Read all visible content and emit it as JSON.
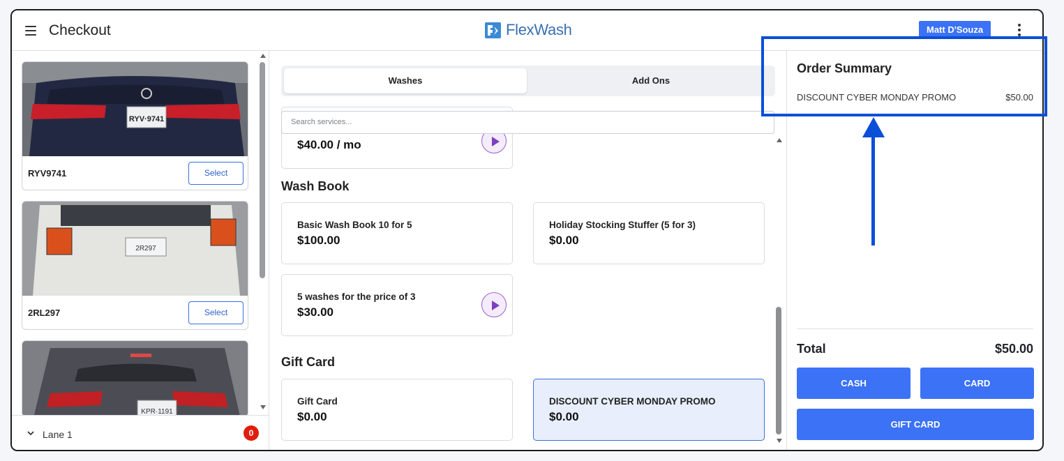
{
  "header": {
    "menu_icon": "hamburger-icon",
    "title": "Checkout",
    "brand": "FlexWash",
    "user": "Matt D'Souza",
    "more_icon": "kebab-menu-icon"
  },
  "vehicles": [
    {
      "plate": "RYV9741",
      "select_label": "Select",
      "photo_plate": "RYV·9741",
      "color": "#2a2f45"
    },
    {
      "plate": "2RL297",
      "select_label": "Select",
      "photo_plate": "2R297",
      "color": "#e6e6e2"
    },
    {
      "plate": "",
      "select_label": "",
      "photo_plate": "KPR·1191",
      "color": "#4a4b52"
    }
  ],
  "lane": {
    "label": "Lane 1",
    "count": "0"
  },
  "tabs": [
    {
      "label": "Washes",
      "active": true
    },
    {
      "label": "Add Ons",
      "active": false
    }
  ],
  "search": {
    "placeholder": "Search services..."
  },
  "services": {
    "partial_card_price": "$40.00 / mo",
    "wash_book": {
      "title": "Wash Book",
      "items": [
        {
          "name": "Basic Wash Book 10 for 5",
          "price": "$100.00"
        },
        {
          "name": "Holiday Stocking Stuffer (5 for 3)",
          "price": "$0.00"
        },
        {
          "name": "5 washes for the price of 3",
          "price": "$30.00"
        }
      ]
    },
    "gift_card": {
      "title": "Gift Card",
      "items": [
        {
          "name": "Gift Card",
          "price": "$0.00"
        },
        {
          "name": "DISCOUNT CYBER MONDAY PROMO",
          "price": "$0.00",
          "selected": true
        }
      ]
    }
  },
  "order_summary": {
    "title": "Order Summary",
    "lines": [
      {
        "name": "DISCOUNT CYBER MONDAY PROMO",
        "price": "$50.00"
      }
    ],
    "total_label": "Total",
    "total_value": "$50.00",
    "buttons": {
      "cash": "CASH",
      "card": "CARD",
      "gift_card": "GIFT CARD"
    }
  },
  "colors": {
    "accent": "#3b72f6",
    "annotation": "#0a4fd8",
    "badge_red": "#e11d0e",
    "play_purple": "#7e3fbf"
  }
}
